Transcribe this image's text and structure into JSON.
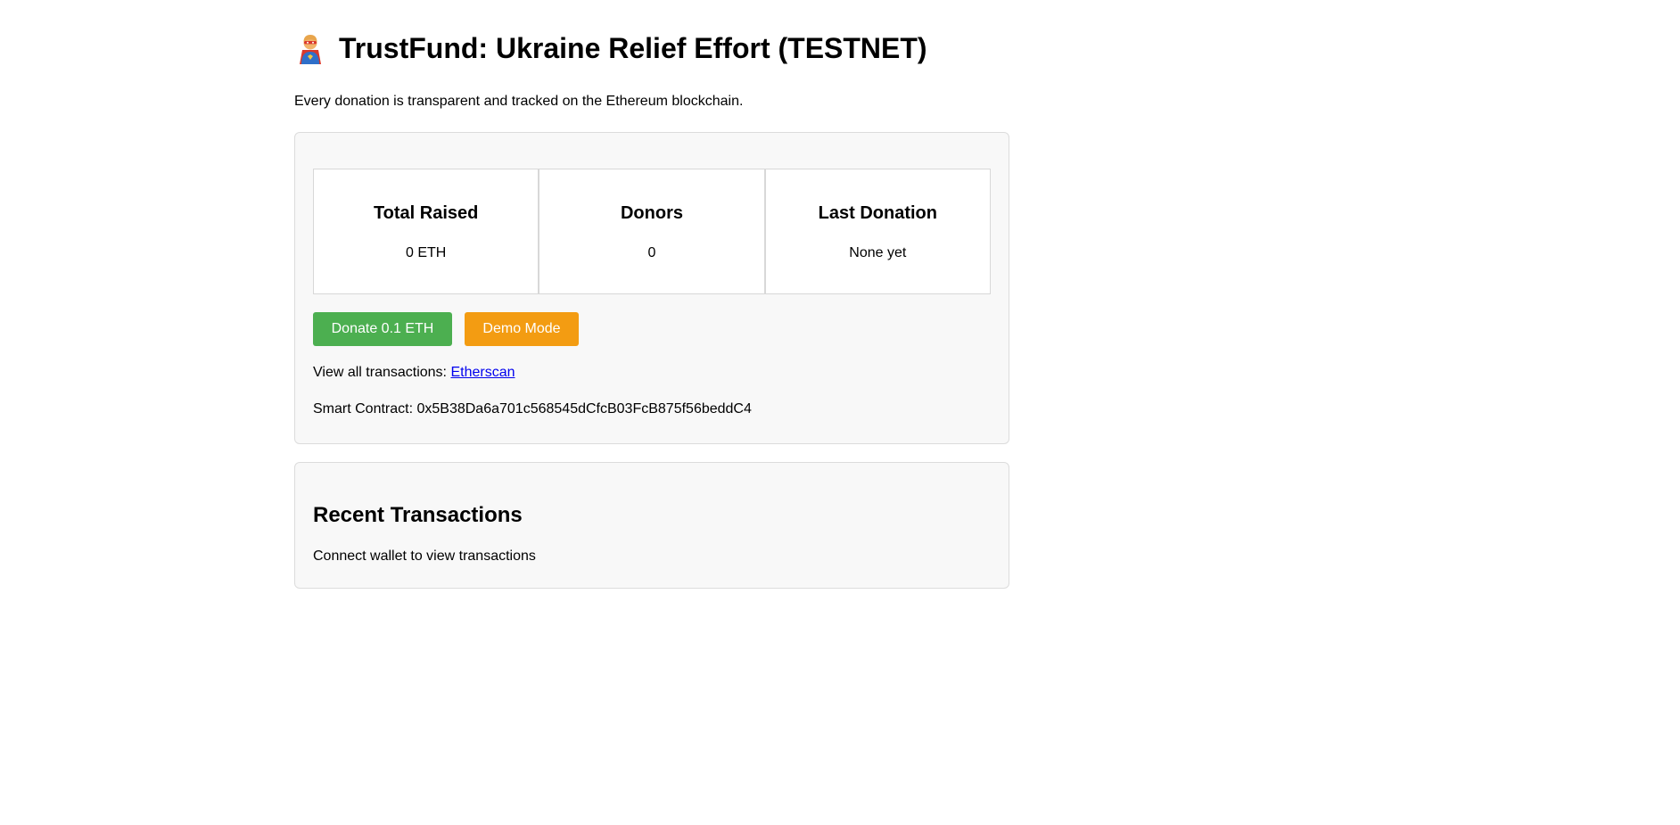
{
  "header": {
    "icon": "superhero-icon",
    "title": "TrustFund: Ukraine Relief Effort (TESTNET)",
    "subtitle": "Every donation is transparent and tracked on the Ethereum blockchain."
  },
  "stats": [
    {
      "label": "Total Raised",
      "value": "0 ETH"
    },
    {
      "label": "Donors",
      "value": "0"
    },
    {
      "label": "Last Donation",
      "value": "None yet"
    }
  ],
  "actions": {
    "donate_label": "Donate 0.1 ETH",
    "donate_color": "#4caf50",
    "demo_label": "Demo Mode",
    "demo_color": "#f39c12"
  },
  "links": {
    "transactions_prefix": "View all transactions:",
    "etherscan_label": "Etherscan"
  },
  "contract": {
    "prefix": "Smart Contract:",
    "address": "0x5B38Da6a701c568545dCfcB03FcB875f56beddC4"
  },
  "recent": {
    "title": "Recent Transactions",
    "message": "Connect wallet to view transactions"
  }
}
